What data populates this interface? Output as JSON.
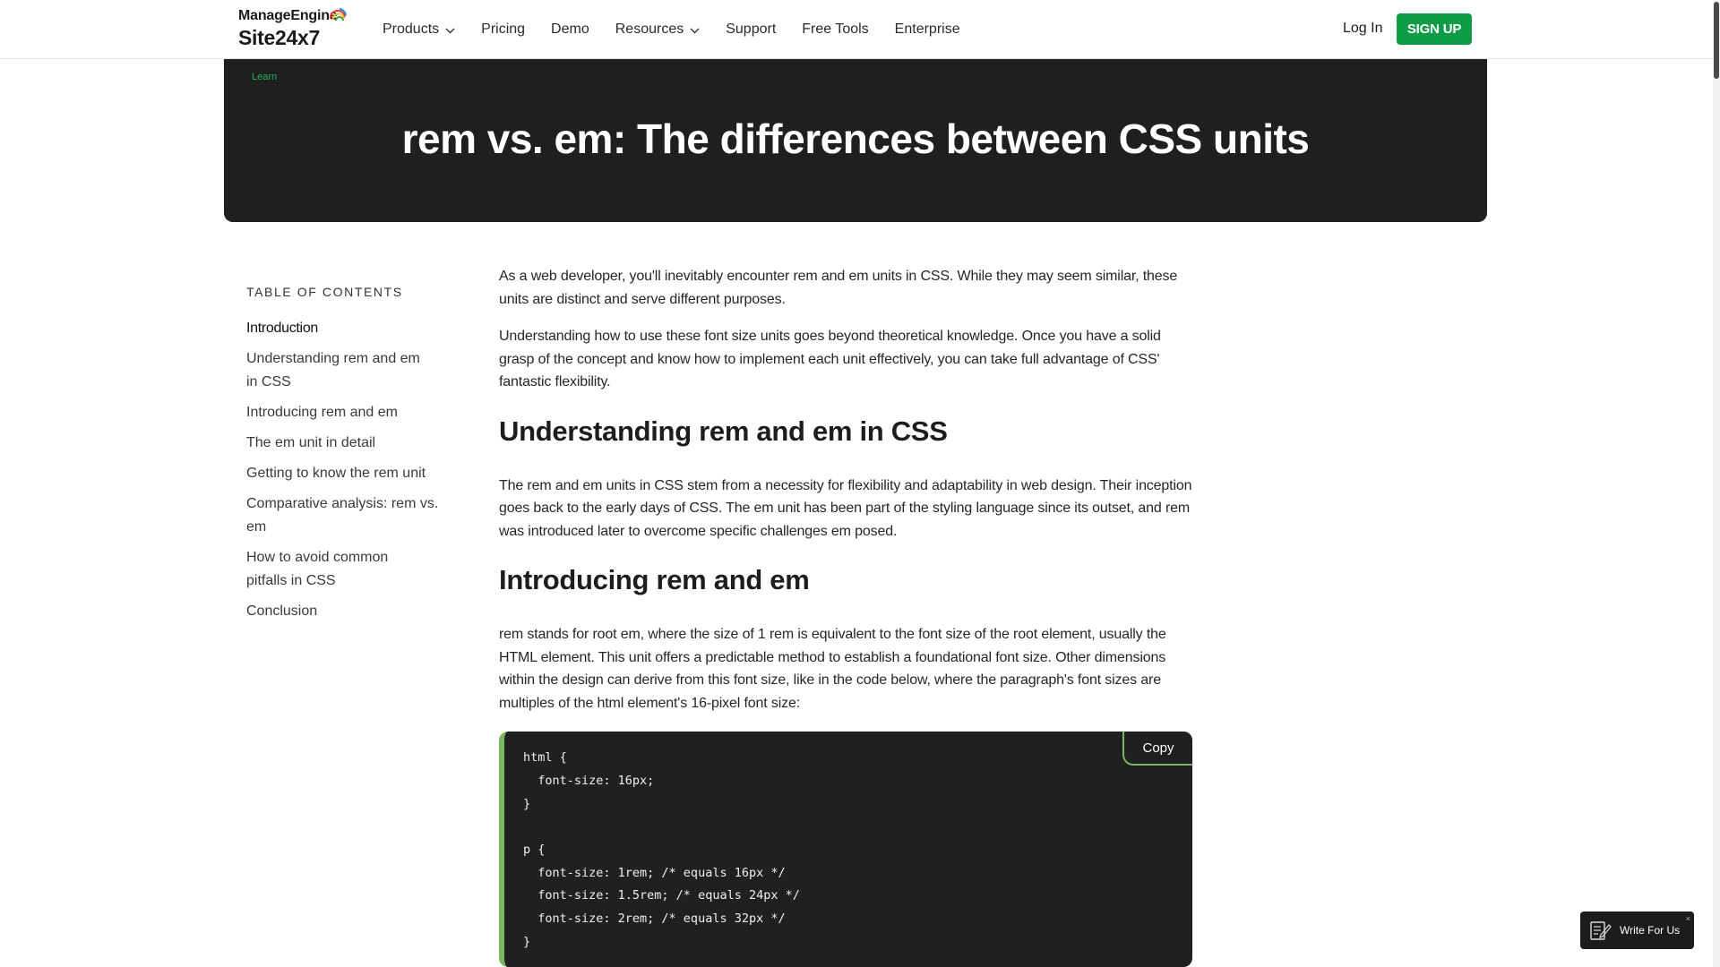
{
  "header": {
    "logo_top": "ManageEngine",
    "logo_bottom": "Site24x7",
    "nav": [
      {
        "label": "Products",
        "dropdown": true
      },
      {
        "label": "Pricing",
        "dropdown": false
      },
      {
        "label": "Demo",
        "dropdown": false
      },
      {
        "label": "Resources",
        "dropdown": true
      },
      {
        "label": "Support",
        "dropdown": false
      },
      {
        "label": "Free Tools",
        "dropdown": false
      },
      {
        "label": "Enterprise",
        "dropdown": false
      }
    ],
    "login": "Log In",
    "signup": "SIGN UP",
    "colors": {
      "signup_bg": "#0e9b46",
      "accent_green": "#21b35a"
    }
  },
  "hero": {
    "breadcrumb": "Learn",
    "title": "rem vs. em: The differences between CSS units"
  },
  "toc": {
    "heading": "TABLE OF CONTENTS",
    "items": [
      "Introduction",
      "Understanding rem and em in CSS",
      "Introducing rem and em",
      "The em unit in detail",
      "Getting to know the rem unit",
      "Comparative analysis: rem vs. em",
      "How to avoid common pitfalls in CSS",
      "Conclusion"
    ]
  },
  "article": {
    "p1": "As a web developer, you'll inevitably encounter rem and em units in CSS. While they may seem similar, these units are distinct and serve different purposes.",
    "p2": "Understanding how to use these font size units goes beyond theoretical knowledge. Once you have a solid grasp of the concept and know how to implement each unit effectively, you can take full advantage of CSS' fantastic flexibility.",
    "h2_1": "Understanding rem and em in CSS",
    "p3": "The rem and em units in CSS stem from a necessity for flexibility and adaptability in web design. Their inception goes back to the early days of CSS. The em unit has been part of the styling language since its outset, and rem was introduced later to overcome specific challenges em posed.",
    "h2_2": "Introducing rem and em",
    "p4": "rem stands for root em, where the size of 1 rem is equivalent to the font size of the root element, usually the HTML element. This unit offers a predictable method to establish a foundational font size. Other dimensions within the design can derive from this font size, like in the code below, where the paragraph's font sizes are multiples of the html element's 16-pixel font size:"
  },
  "code": {
    "copy_label": "Copy",
    "lines": [
      "html {",
      "  font-size: 16px;",
      "}",
      "",
      "p {",
      "  font-size: 1rem; /* equals 16px */",
      "  font-size: 1.5rem; /* equals 24px */",
      "  font-size: 2rem; /* equals 32px */",
      "}"
    ]
  },
  "widget": {
    "label": "Write For Us",
    "close": "×"
  }
}
